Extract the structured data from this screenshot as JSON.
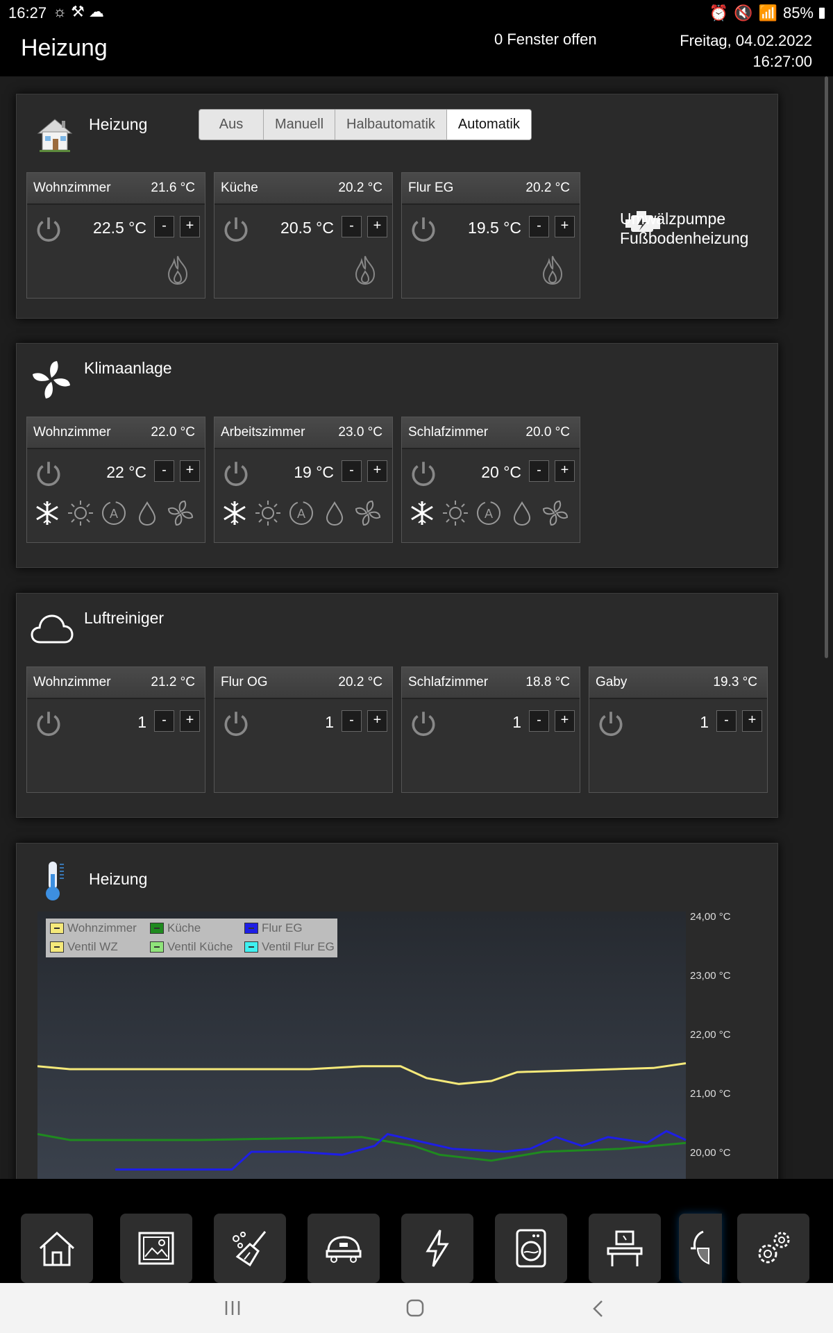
{
  "status": {
    "time": "16:27",
    "battery": "85%"
  },
  "header": {
    "title": "Heizung",
    "windows": "0 Fenster offen",
    "date": "Freitag, 04.02.2022",
    "time": "16:27:00"
  },
  "heizung": {
    "title": "Heizung",
    "modes": [
      "Aus",
      "Manuell",
      "Halbautomatik",
      "Automatik"
    ],
    "active_mode": "Automatik",
    "rooms": [
      {
        "name": "Wohnzimmer",
        "current": "21.6 °C",
        "set": "22.5 °C"
      },
      {
        "name": "Küche",
        "current": "20.2 °C",
        "set": "20.5 °C"
      },
      {
        "name": "Flur EG",
        "current": "20.2 °C",
        "set": "19.5 °C"
      }
    ],
    "pump_line1": "Umwälzpumpe",
    "pump_line2": "Fußbodenheizung"
  },
  "klima": {
    "title": "Klimaanlage",
    "rooms": [
      {
        "name": "Wohnzimmer",
        "current": "22.0 °C",
        "set": "22 °C"
      },
      {
        "name": "Arbeitszimmer",
        "current": "23.0 °C",
        "set": "19 °C"
      },
      {
        "name": "Schlafzimmer",
        "current": "20.0 °C",
        "set": "20 °C"
      }
    ]
  },
  "luft": {
    "title": "Luftreiniger",
    "rooms": [
      {
        "name": "Wohnzimmer",
        "current": "21.2 °C",
        "set": "1"
      },
      {
        "name": "Flur OG",
        "current": "20.2 °C",
        "set": "1"
      },
      {
        "name": "Schlafzimmer",
        "current": "18.8 °C",
        "set": "1"
      },
      {
        "name": "Gaby",
        "current": "19.3 °C",
        "set": "1"
      }
    ]
  },
  "controls": {
    "minus": "-",
    "plus": "+"
  },
  "chart": {
    "title": "Heizung"
  },
  "chart_data": {
    "type": "line",
    "ylim": [
      19.7,
      24.0
    ],
    "y_ticks": [
      "24,00 °C",
      "23,00 °C",
      "22,00 °C",
      "21,00 °C",
      "20,00 °C"
    ],
    "legend_position": "top-left",
    "series": [
      {
        "name": "Wohnzimmer",
        "color": "#f5e97a",
        "points": [
          [
            0,
            21.45
          ],
          [
            0.05,
            21.4
          ],
          [
            0.42,
            21.4
          ],
          [
            0.5,
            21.45
          ],
          [
            0.56,
            21.45
          ],
          [
            0.6,
            21.25
          ],
          [
            0.65,
            21.15
          ],
          [
            0.7,
            21.2
          ],
          [
            0.74,
            21.35
          ],
          [
            0.95,
            21.42
          ],
          [
            1,
            21.5
          ]
        ]
      },
      {
        "name": "Küche",
        "color": "#1f8a1f",
        "points": [
          [
            0,
            20.3
          ],
          [
            0.05,
            20.2
          ],
          [
            0.25,
            20.2
          ],
          [
            0.5,
            20.25
          ],
          [
            0.58,
            20.1
          ],
          [
            0.62,
            19.95
          ],
          [
            0.7,
            19.85
          ],
          [
            0.78,
            20.0
          ],
          [
            0.9,
            20.05
          ],
          [
            1,
            20.15
          ]
        ]
      },
      {
        "name": "Flur EG",
        "color": "#1e1ee6",
        "points": [
          [
            0.12,
            19.7
          ],
          [
            0.2,
            19.7
          ],
          [
            0.3,
            19.7
          ],
          [
            0.33,
            20.0
          ],
          [
            0.4,
            20.0
          ],
          [
            0.47,
            19.95
          ],
          [
            0.52,
            20.1
          ],
          [
            0.54,
            20.3
          ],
          [
            0.58,
            20.2
          ],
          [
            0.64,
            20.05
          ],
          [
            0.72,
            20.0
          ],
          [
            0.76,
            20.05
          ],
          [
            0.8,
            20.25
          ],
          [
            0.84,
            20.1
          ],
          [
            0.88,
            20.25
          ],
          [
            0.94,
            20.15
          ],
          [
            0.97,
            20.35
          ],
          [
            1,
            20.2
          ]
        ]
      },
      {
        "name": "Ventil WZ",
        "color": "#f5e97a",
        "points": []
      },
      {
        "name": "Ventil Küche",
        "color": "#8fe37a",
        "points": []
      },
      {
        "name": "Ventil Flur EG",
        "color": "#3ff0f0",
        "points": []
      }
    ]
  },
  "dock": [
    "home-icon",
    "image-icon",
    "broom-icon",
    "robot-vacuum-icon",
    "lightning-icon",
    "washing-machine-icon",
    "desk-icon",
    "lamp-icon",
    "gear-icon"
  ]
}
